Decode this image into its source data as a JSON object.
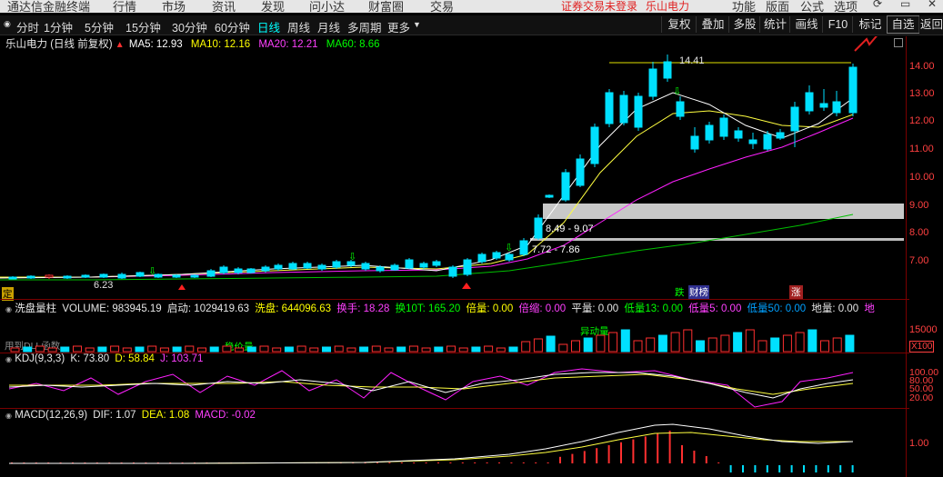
{
  "menubar": {
    "app_title": "通达信金融终端",
    "items": [
      "行情",
      "市场",
      "资讯",
      "发现",
      "问小达",
      "财富圈",
      "交易"
    ],
    "notice": "证券交易未登录",
    "stock_name": "乐山电力",
    "right_items": [
      "功能",
      "版面",
      "公式",
      "选项"
    ]
  },
  "toolbar": {
    "periods": [
      "分时",
      "1分钟",
      "5分钟",
      "15分钟",
      "30分钟",
      "60分钟",
      "日线",
      "周线",
      "月线",
      "多周期",
      "更多"
    ],
    "active_period": "日线",
    "buttons": [
      "复权",
      "叠加",
      "多股",
      "统计",
      "画线",
      "F10",
      "标记",
      "自选",
      "返回"
    ]
  },
  "main_chart": {
    "title": "乐山电力 (日线 前复权)",
    "ma": [
      {
        "label": "MA5: 12.93",
        "color": "#ffffff"
      },
      {
        "label": "MA10: 12.16",
        "color": "#ffff00"
      },
      {
        "label": "MA20: 12.21",
        "color": "#ff00ff"
      },
      {
        "label": "MA60: 8.66",
        "color": "#00ff00"
      }
    ],
    "y_ticks": [
      "14.00",
      "13.00",
      "12.00",
      "11.00",
      "10.00",
      "9.00",
      "8.00",
      "7.00"
    ],
    "high_label": "14.41",
    "low_label": "6.23",
    "range_upper": "8.49 - 9.07",
    "range_lower": "7.72 - 7.86",
    "badge_left": "定",
    "tag_die": "跌",
    "tag_caibang": "财榜",
    "tag_zhang": "涨"
  },
  "volume_panel": {
    "name": "洗盘量柱",
    "items": [
      {
        "label": "VOLUME: 983945.19",
        "color": "#e6e6e6"
      },
      {
        "label": "启动: 1029419.63",
        "color": "#e6e6e6"
      },
      {
        "label": "洗盘: 644096.63",
        "color": "#ffff00"
      },
      {
        "label": "换手: 18.28",
        "color": "#ff40ff"
      },
      {
        "label": "换10T: 165.20",
        "color": "#00ff00"
      },
      {
        "label": "倍量: 0.00",
        "color": "#ffff00"
      },
      {
        "label": "倍缩: 0.00",
        "color": "#ff40ff"
      },
      {
        "label": "平量: 0.00",
        "color": "#e6e6e6"
      },
      {
        "label": "低量13: 0.00",
        "color": "#00ff00"
      },
      {
        "label": "低量5: 0.00",
        "color": "#ff40ff"
      },
      {
        "label": "低量50: 0.00",
        "color": "#00a0ff"
      },
      {
        "label": "地量: 0.00",
        "color": "#e6e6e6"
      },
      {
        "label": "地",
        "color": "#ff40ff"
      }
    ],
    "y_tick": "15000",
    "unit": "X100",
    "dll_hint": "用到DLL函数",
    "label_wenjia": "稳价量",
    "label_yidong": "异动量"
  },
  "kdj_panel": {
    "name": "KDJ(9,3,3)",
    "items": [
      {
        "label": "K: 73.80",
        "color": "#e6e6e6"
      },
      {
        "label": "D: 58.84",
        "color": "#ffff00"
      },
      {
        "label": "J: 103.71",
        "color": "#ff40ff"
      }
    ],
    "y_ticks": [
      "100.00",
      "80.00",
      "50.00",
      "20.00"
    ]
  },
  "macd_panel": {
    "name": "MACD(12,26,9)",
    "items": [
      {
        "label": "DIF: 1.07",
        "color": "#e6e6e6"
      },
      {
        "label": "DEA: 1.08",
        "color": "#ffff00"
      },
      {
        "label": "MACD: -0.02",
        "color": "#ff40ff"
      }
    ],
    "y_tick": "1.00"
  }
}
